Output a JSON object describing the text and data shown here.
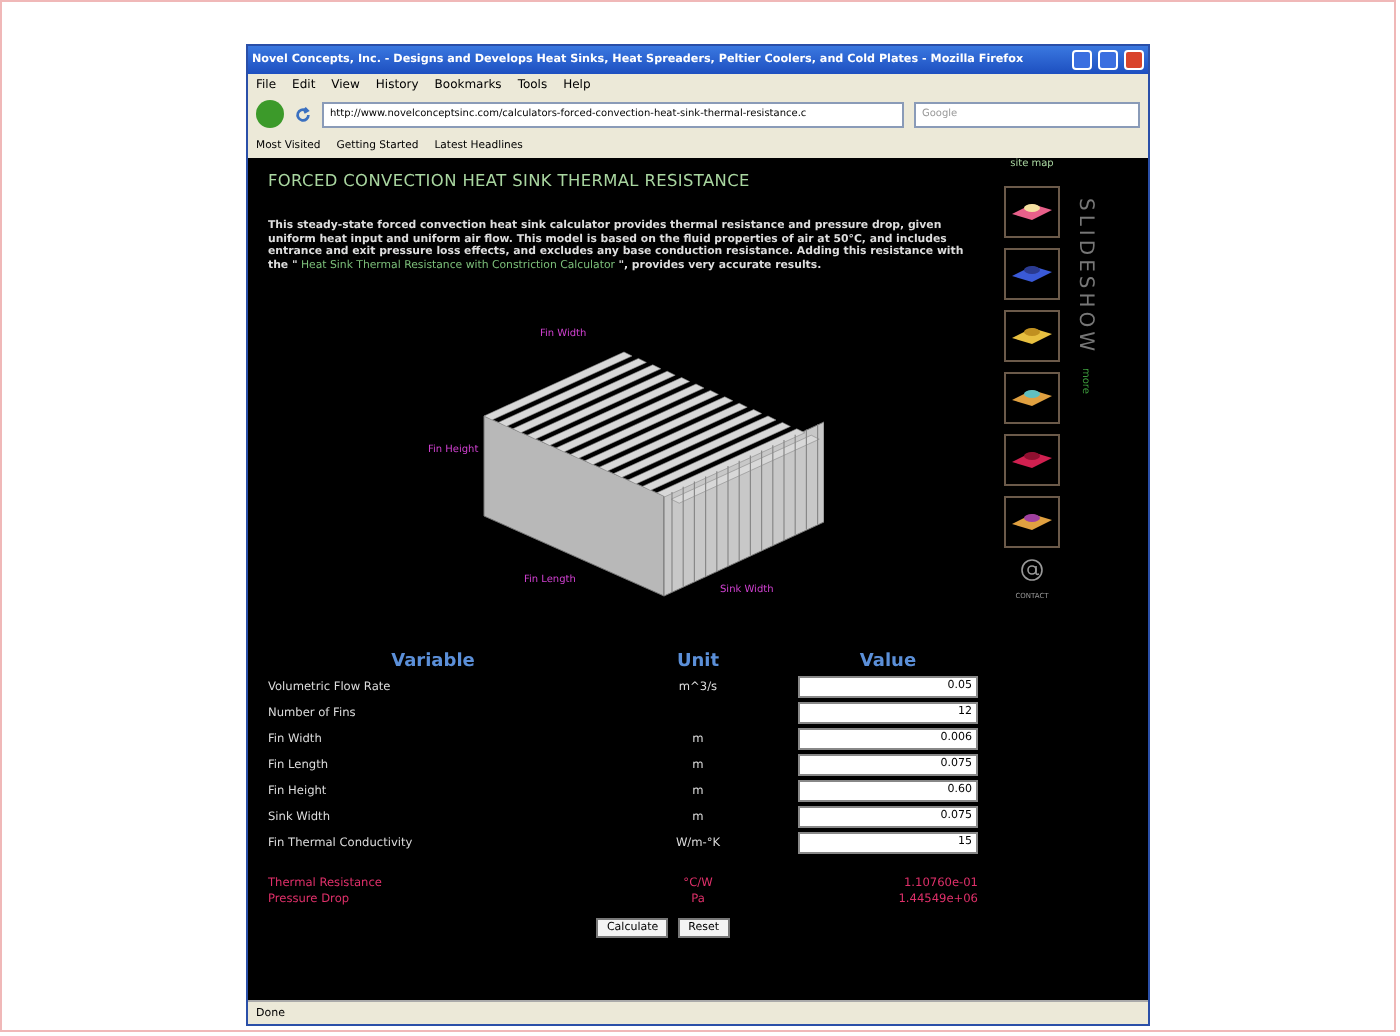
{
  "window": {
    "title": "Novel Concepts, Inc. - Designs and Develops Heat Sinks, Heat Spreaders, Peltier Coolers, and Cold Plates - Mozilla Firefox"
  },
  "menu": [
    "File",
    "Edit",
    "View",
    "History",
    "Bookmarks",
    "Tools",
    "Help"
  ],
  "address": {
    "value": "http://www.novelconceptsinc.com/calculators-forced-convection-heat-sink-thermal-resistance.c"
  },
  "search": {
    "placeholder": "Google"
  },
  "bookmarks": [
    "Most Visited",
    "Getting Started",
    "Latest Headlines"
  ],
  "page": {
    "heading": "FORCED CONVECTION HEAT SINK THERMAL RESISTANCE",
    "intro": "This steady-state forced convection heat sink calculator provides thermal resistance and pressure drop, given uniform heat input and uniform air flow. This model is based on the fluid properties of air at 50°C, and includes entrance and exit pressure loss effects, and excludes any base conduction resistance. Adding this resistance with the \"",
    "link": " Heat Sink Thermal Resistance with Constriction Calculator ",
    "intro_end": "\", provides very accurate results.",
    "diagram_labels": [
      "Fin Width",
      "Fin Height",
      "Fin Length",
      "Sink Width"
    ],
    "columns": [
      "Variable",
      "Unit",
      "Value"
    ],
    "inputs": [
      {
        "variable": "Volumetric Flow Rate",
        "unit": "m^3/s",
        "value": "0.05"
      },
      {
        "variable": "Number of Fins",
        "value": "12"
      },
      {
        "variable": "Fin Width",
        "unit": "m",
        "value": "0.006"
      },
      {
        "variable": "Fin Length",
        "unit": "m",
        "value": "0.075"
      },
      {
        "variable": "Fin Height",
        "unit": "m",
        "value": "0.60"
      },
      {
        "variable": "Sink Width",
        "unit": "m",
        "value": "0.075"
      },
      {
        "variable": "Fin Thermal Conductivity",
        "unit": "W/m-°K",
        "value": "15"
      }
    ],
    "results": [
      {
        "variable": "Thermal Resistance",
        "unit": "°C/W",
        "value": "1.10760e-01"
      },
      {
        "variable": "Pressure Drop",
        "unit": "Pa",
        "value": "1.44549e+06"
      }
    ],
    "buttons": [
      "Calculate",
      "Reset"
    ]
  },
  "sidebar": {
    "site_map": "site map",
    "slideshow": "SLIDESHOW",
    "more": "more",
    "contact": "CONTACT"
  },
  "status_bar": "Done"
}
